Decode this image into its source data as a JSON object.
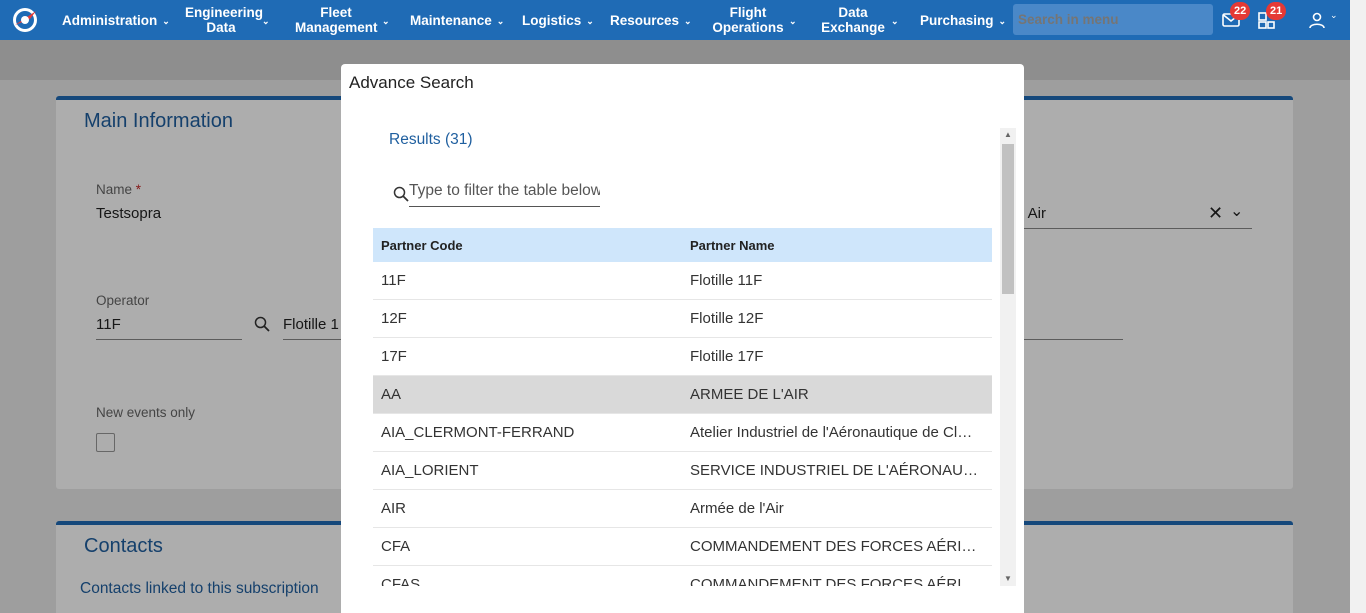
{
  "navbar": {
    "items": [
      {
        "label": "Administration"
      },
      {
        "label": "Engineering Data"
      },
      {
        "label": "Fleet Management"
      },
      {
        "label": "Maintenance"
      },
      {
        "label": "Logistics"
      },
      {
        "label": "Resources"
      },
      {
        "label": "Flight Operations"
      },
      {
        "label": "Data Exchange"
      },
      {
        "label": "Purchasing"
      }
    ],
    "search_placeholder": "Search in menu",
    "mail_badge": "22",
    "tasks_badge": "21"
  },
  "main_info": {
    "title": "Main Information",
    "name_label": "Name",
    "name_required": "*",
    "name_value": "Testsopra",
    "operator_label": "Operator",
    "operator_code": "11F",
    "operator_name": "Flotille 1",
    "right_value": "e Air",
    "new_events_label": "New events only"
  },
  "contacts": {
    "title": "Contacts",
    "linked_link": "Contacts linked to this subscription"
  },
  "modal": {
    "title": "Advance Search",
    "results": "Results (31)",
    "filter_placeholder": "Type to filter the table below",
    "col_code": "Partner Code",
    "col_name": "Partner Name",
    "rows": [
      {
        "code": "11F",
        "name": "Flotille 11F"
      },
      {
        "code": "12F",
        "name": "Flotille 12F"
      },
      {
        "code": "17F",
        "name": "Flotille 17F"
      },
      {
        "code": "AA",
        "name": "ARMEE DE L'AIR"
      },
      {
        "code": "AIA_CLERMONT-FERRAND",
        "name": "Atelier Industriel de l'Aéronautique de Clermont-Ferrand"
      },
      {
        "code": "AIA_LORIENT",
        "name": "SERVICE INDUSTRIEL DE L'AÉRONAUTIQUE"
      },
      {
        "code": "AIR",
        "name": "Armée de l'Air"
      },
      {
        "code": "CFA",
        "name": "COMMANDEMENT DES FORCES AÉRIENNES"
      },
      {
        "code": "CFAS",
        "name": "COMMANDEMENT DES FORCES AÉRIENNES"
      }
    ],
    "selected_index": 3
  },
  "colors": {
    "brand": "#1f6bb5",
    "header_row": "#cfe6fb",
    "link": "#1f5f9f",
    "badge": "#e53935"
  }
}
